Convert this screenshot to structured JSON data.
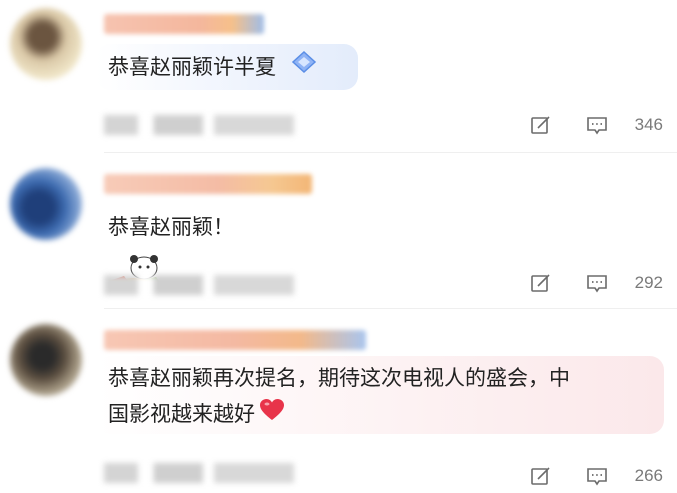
{
  "comments": [
    {
      "text": "恭喜赵丽颖许半夏",
      "likes": "346"
    },
    {
      "text": "恭喜赵丽颖！",
      "likes": "292"
    },
    {
      "text_line1": "恭喜赵丽颖再次提名，期待这次电视人的盛会，中",
      "text_line2": "国影视越来越好",
      "emoji": "❤️",
      "likes": "266"
    }
  ],
  "colors": {
    "bubble_blue": "#eaf1fd",
    "bubble_pink": "#fdeef0",
    "heart": "#e8344a",
    "icon": "#6b6b6b"
  },
  "icons": [
    "edit-icon",
    "comment-icon",
    "thumbs-up-icon"
  ]
}
